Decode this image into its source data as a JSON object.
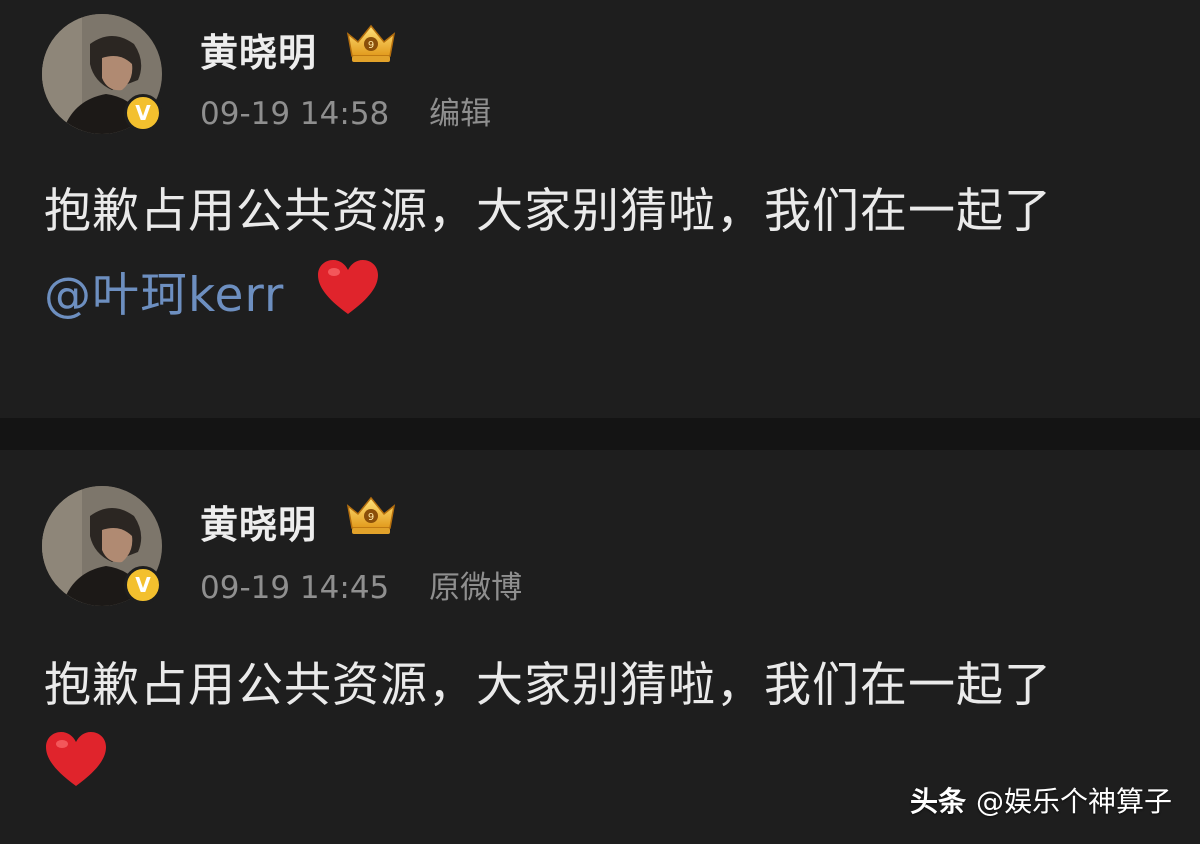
{
  "posts": [
    {
      "author": "黄晓明",
      "time": "09-19 14:58",
      "source": "编辑",
      "text": "抱歉占用公共资源，大家别猜啦，我们在一起了",
      "mention": "@叶珂kerr",
      "badge": "V",
      "level_icon": "crown-level-9-icon"
    },
    {
      "author": "黄晓明",
      "time": "09-19 14:45",
      "source": "原微博",
      "text": "抱歉占用公共资源，大家别猜啦，我们在一起了",
      "badge": "V",
      "level_icon": "crown-level-9-icon"
    }
  ],
  "watermark": {
    "brand": "头条",
    "account": "@娱乐个神算子"
  },
  "colors": {
    "background": "#1e1e1e",
    "mention": "#6d8fc0",
    "verified_badge": "#f3c02e",
    "heart": "#e0242c"
  }
}
